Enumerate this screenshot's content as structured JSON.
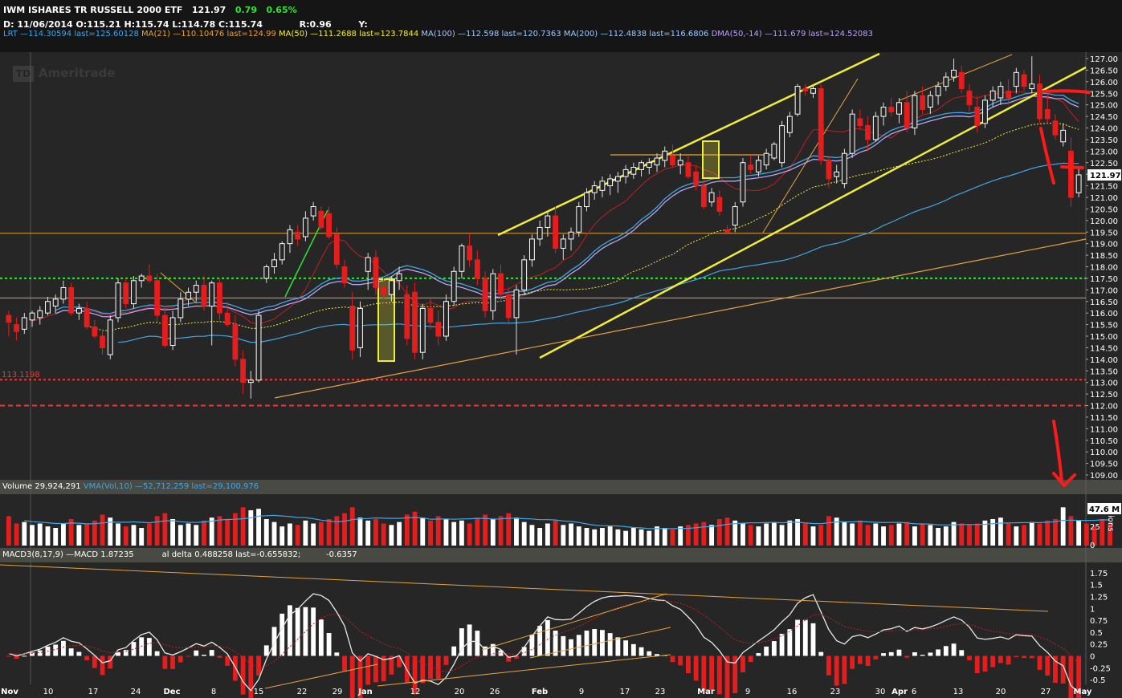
{
  "header": {
    "symbol_line": "IWM ISHARES TR RUSSELL 2000 ETF",
    "last": "121.97",
    "change": "0.79",
    "change_pct": "0.65%",
    "ohlc_line": "D: 11/06/2014 O:115.21 H:115.74 L:114.78 C:115.74",
    "r_label": "R:0.96",
    "y_label": "Y:",
    "studies": [
      {
        "text": "LRT —114.30594 last=125.60128",
        "color": "#3fa6e6"
      },
      {
        "text": "MA(21) —110.10476 last=124.99",
        "color": "#e6a23c"
      },
      {
        "text": "MA(50) —111.2688 last=123.7844",
        "color": "#f2ee35"
      },
      {
        "text": "MA(100) —112.598 last=120.7363",
        "color": "#9ec9ff"
      },
      {
        "text": "MA(200) —112.4838 last=116.6806",
        "color": "#9ec9ff"
      },
      {
        "text": "DMA(50,-14) —111.679 last=124.52083",
        "color": "#b9a3f0"
      }
    ]
  },
  "watermark": {
    "logo": "TD",
    "text": "Ameritrade"
  },
  "price_panel": {
    "last_badge": "121.97",
    "level_label": "113.1198",
    "y_ticks": [
      "127.00",
      "126.50",
      "126.00",
      "125.50",
      "125.00",
      "124.50",
      "124.00",
      "123.50",
      "123.00",
      "122.50",
      "122.00",
      "121.50",
      "121.00",
      "120.50",
      "120.00",
      "119.50",
      "119.00",
      "118.50",
      "118.00",
      "117.50",
      "117.00",
      "116.50",
      "116.00",
      "115.50",
      "115.00",
      "114.50",
      "114.00",
      "113.50",
      "113.00",
      "112.50",
      "112.00",
      "111.50",
      "111.00",
      "110.50",
      "110.00",
      "109.50",
      "109.00"
    ]
  },
  "volume_panel": {
    "label": "Volume 29,924,291",
    "vma_label": "VMA(Vol,10) —52,712,259 last=29,100,976",
    "badge": "47.6 M",
    "y_ticks": [
      "25",
      "0"
    ],
    "unit": "ions"
  },
  "macd_panel": {
    "label": "MACD3(8,17,9) —MACD 1.87235",
    "delta_label": "al delta 0.488258 last=-0.655832;",
    "last_label": "-0.6357",
    "y_ticks": [
      "1.75",
      "1.5",
      "1.25",
      "1",
      "0.75",
      "0.5",
      "0.25",
      "0",
      "-0.25",
      "-0.5"
    ]
  },
  "x_axis": {
    "labels": [
      "Nov",
      "10",
      "17",
      "24",
      "Dec",
      "8",
      "15",
      "22",
      "29",
      "Jan",
      "12",
      "20",
      "26",
      "Feb",
      "9",
      "17",
      "23",
      "Mar",
      "9",
      "16",
      "23",
      "30",
      "Apr",
      "6",
      "13",
      "20",
      "27",
      "May"
    ]
  },
  "chart_data": {
    "type": "candlestick",
    "ylim": [
      109.0,
      127.0
    ],
    "levels": [
      119.45,
      117.5,
      116.65,
      113.12,
      112.0
    ],
    "candles": [
      {
        "o": 115.9,
        "h": 116.1,
        "l": 115.0,
        "c": 115.6
      },
      {
        "o": 115.5,
        "h": 115.8,
        "l": 114.8,
        "c": 115.2
      },
      {
        "o": 115.3,
        "h": 116.0,
        "l": 115.1,
        "c": 115.8
      },
      {
        "o": 115.7,
        "h": 116.1,
        "l": 115.4,
        "c": 116.0
      },
      {
        "o": 115.8,
        "h": 116.3,
        "l": 115.5,
        "c": 116.1
      },
      {
        "o": 116.0,
        "h": 116.7,
        "l": 115.9,
        "c": 116.5
      },
      {
        "o": 116.3,
        "h": 116.8,
        "l": 116.0,
        "c": 116.6
      },
      {
        "o": 116.6,
        "h": 117.4,
        "l": 116.4,
        "c": 117.1
      },
      {
        "o": 117.1,
        "h": 117.3,
        "l": 115.9,
        "c": 116.0
      },
      {
        "o": 116.0,
        "h": 116.4,
        "l": 115.7,
        "c": 116.2
      },
      {
        "o": 116.2,
        "h": 116.5,
        "l": 115.3,
        "c": 115.4
      },
      {
        "o": 115.4,
        "h": 115.7,
        "l": 114.9,
        "c": 115.0
      },
      {
        "o": 115.0,
        "h": 115.3,
        "l": 114.2,
        "c": 114.5
      },
      {
        "o": 114.2,
        "h": 115.9,
        "l": 114.0,
        "c": 115.7
      },
      {
        "o": 115.8,
        "h": 117.5,
        "l": 115.6,
        "c": 117.3
      },
      {
        "o": 117.3,
        "h": 117.5,
        "l": 116.2,
        "c": 116.4
      },
      {
        "o": 116.4,
        "h": 117.6,
        "l": 116.2,
        "c": 117.4
      },
      {
        "o": 117.4,
        "h": 117.7,
        "l": 117.1,
        "c": 117.6
      },
      {
        "o": 117.6,
        "h": 118.1,
        "l": 117.3,
        "c": 117.4
      },
      {
        "o": 117.4,
        "h": 117.7,
        "l": 115.6,
        "c": 115.9
      },
      {
        "o": 115.9,
        "h": 116.3,
        "l": 114.5,
        "c": 114.6
      },
      {
        "o": 114.6,
        "h": 116.1,
        "l": 114.4,
        "c": 115.8
      },
      {
        "o": 115.8,
        "h": 116.9,
        "l": 115.6,
        "c": 116.6
      },
      {
        "o": 116.6,
        "h": 117.1,
        "l": 116.3,
        "c": 116.9
      },
      {
        "o": 116.9,
        "h": 117.4,
        "l": 116.5,
        "c": 117.2
      },
      {
        "o": 117.2,
        "h": 117.6,
        "l": 116.1,
        "c": 116.3
      },
      {
        "o": 116.3,
        "h": 117.4,
        "l": 114.6,
        "c": 117.3
      },
      {
        "o": 117.3,
        "h": 117.5,
        "l": 115.7,
        "c": 116.0
      },
      {
        "o": 116.0,
        "h": 116.5,
        "l": 115.4,
        "c": 115.5
      },
      {
        "o": 115.5,
        "h": 115.9,
        "l": 113.7,
        "c": 114.0
      },
      {
        "o": 114.0,
        "h": 114.4,
        "l": 112.5,
        "c": 113.0
      },
      {
        "o": 113.0,
        "h": 113.5,
        "l": 112.3,
        "c": 113.1
      },
      {
        "o": 113.1,
        "h": 116.1,
        "l": 113.0,
        "c": 115.9
      },
      {
        "o": 117.5,
        "h": 118.1,
        "l": 117.3,
        "c": 118.0
      },
      {
        "o": 118.0,
        "h": 118.6,
        "l": 117.7,
        "c": 118.3
      },
      {
        "o": 118.3,
        "h": 119.1,
        "l": 118.1,
        "c": 119.0
      },
      {
        "o": 119.0,
        "h": 119.8,
        "l": 118.6,
        "c": 119.6
      },
      {
        "o": 119.5,
        "h": 119.8,
        "l": 118.9,
        "c": 119.2
      },
      {
        "o": 119.3,
        "h": 120.4,
        "l": 119.1,
        "c": 120.1
      },
      {
        "o": 120.2,
        "h": 120.8,
        "l": 120.0,
        "c": 120.6
      },
      {
        "o": 120.4,
        "h": 120.6,
        "l": 119.6,
        "c": 119.7
      },
      {
        "o": 120.3,
        "h": 120.6,
        "l": 119.2,
        "c": 119.3
      },
      {
        "o": 119.4,
        "h": 119.7,
        "l": 117.9,
        "c": 118.1
      },
      {
        "o": 118.0,
        "h": 118.3,
        "l": 117.1,
        "c": 117.3
      },
      {
        "o": 116.3,
        "h": 116.9,
        "l": 114.0,
        "c": 114.4
      },
      {
        "o": 114.5,
        "h": 116.5,
        "l": 114.1,
        "c": 116.2
      },
      {
        "o": 117.8,
        "h": 118.6,
        "l": 117.0,
        "c": 118.4
      },
      {
        "o": 118.4,
        "h": 118.7,
        "l": 116.8,
        "c": 117.1
      },
      {
        "o": 117.1,
        "h": 117.5,
        "l": 116.3,
        "c": 116.8
      },
      {
        "o": 116.8,
        "h": 117.6,
        "l": 116.5,
        "c": 117.4
      },
      {
        "o": 117.4,
        "h": 118.0,
        "l": 117.0,
        "c": 117.7
      },
      {
        "o": 116.8,
        "h": 117.2,
        "l": 114.6,
        "c": 114.9
      },
      {
        "o": 116.9,
        "h": 117.3,
        "l": 114.0,
        "c": 114.3
      },
      {
        "o": 114.3,
        "h": 116.4,
        "l": 114.0,
        "c": 116.2
      },
      {
        "o": 116.2,
        "h": 116.6,
        "l": 115.3,
        "c": 115.6
      },
      {
        "o": 115.6,
        "h": 116.1,
        "l": 114.6,
        "c": 115.0
      },
      {
        "o": 115.0,
        "h": 116.8,
        "l": 114.8,
        "c": 116.5
      },
      {
        "o": 116.5,
        "h": 118.0,
        "l": 116.3,
        "c": 117.8
      },
      {
        "o": 117.8,
        "h": 119.0,
        "l": 117.5,
        "c": 118.9
      },
      {
        "o": 118.9,
        "h": 119.5,
        "l": 118.0,
        "c": 118.3
      },
      {
        "o": 118.3,
        "h": 118.7,
        "l": 117.2,
        "c": 117.5
      },
      {
        "o": 117.5,
        "h": 117.8,
        "l": 115.8,
        "c": 116.1
      },
      {
        "o": 116.1,
        "h": 117.9,
        "l": 115.7,
        "c": 117.7
      },
      {
        "o": 117.7,
        "h": 118.1,
        "l": 116.5,
        "c": 116.8
      },
      {
        "o": 116.8,
        "h": 117.1,
        "l": 115.5,
        "c": 115.8
      },
      {
        "o": 115.8,
        "h": 117.2,
        "l": 114.2,
        "c": 117.0
      },
      {
        "o": 117.0,
        "h": 118.5,
        "l": 116.8,
        "c": 118.3
      },
      {
        "o": 118.3,
        "h": 119.4,
        "l": 118.0,
        "c": 119.2
      },
      {
        "o": 119.2,
        "h": 120.0,
        "l": 118.9,
        "c": 119.7
      },
      {
        "o": 119.7,
        "h": 120.4,
        "l": 119.3,
        "c": 120.2
      },
      {
        "o": 120.2,
        "h": 120.6,
        "l": 118.6,
        "c": 118.8
      },
      {
        "o": 118.8,
        "h": 119.4,
        "l": 118.3,
        "c": 119.2
      },
      {
        "o": 119.2,
        "h": 119.7,
        "l": 118.7,
        "c": 119.5
      },
      {
        "o": 119.5,
        "h": 120.8,
        "l": 119.3,
        "c": 120.6
      },
      {
        "o": 120.6,
        "h": 121.4,
        "l": 120.4,
        "c": 121.2
      },
      {
        "o": 121.2,
        "h": 121.7,
        "l": 120.9,
        "c": 121.5
      },
      {
        "o": 121.3,
        "h": 121.9,
        "l": 121.0,
        "c": 121.7
      },
      {
        "o": 121.5,
        "h": 122.0,
        "l": 121.1,
        "c": 121.8
      },
      {
        "o": 121.7,
        "h": 122.1,
        "l": 121.2,
        "c": 121.9
      },
      {
        "o": 121.9,
        "h": 122.4,
        "l": 121.6,
        "c": 122.2
      },
      {
        "o": 122.0,
        "h": 122.5,
        "l": 121.8,
        "c": 122.3
      },
      {
        "o": 122.2,
        "h": 122.6,
        "l": 121.9,
        "c": 122.5
      },
      {
        "o": 122.3,
        "h": 122.7,
        "l": 122.0,
        "c": 122.5
      },
      {
        "o": 122.4,
        "h": 122.9,
        "l": 122.1,
        "c": 122.7
      },
      {
        "o": 122.6,
        "h": 123.2,
        "l": 122.3,
        "c": 123.0
      },
      {
        "o": 122.8,
        "h": 123.3,
        "l": 122.3,
        "c": 122.4
      },
      {
        "o": 122.4,
        "h": 122.9,
        "l": 122.0,
        "c": 122.6
      },
      {
        "o": 122.5,
        "h": 122.8,
        "l": 121.8,
        "c": 121.9
      },
      {
        "o": 122.1,
        "h": 122.4,
        "l": 121.3,
        "c": 121.5
      },
      {
        "o": 121.5,
        "h": 121.8,
        "l": 120.5,
        "c": 120.6
      },
      {
        "o": 120.8,
        "h": 121.4,
        "l": 120.6,
        "c": 121.2
      },
      {
        "o": 121.0,
        "h": 121.3,
        "l": 120.2,
        "c": 120.4
      },
      {
        "o": 119.6,
        "h": 119.8,
        "l": 119.4,
        "c": 119.5
      },
      {
        "o": 119.8,
        "h": 120.8,
        "l": 119.5,
        "c": 120.6
      },
      {
        "o": 120.8,
        "h": 122.7,
        "l": 120.6,
        "c": 122.5
      },
      {
        "o": 122.4,
        "h": 122.8,
        "l": 122.0,
        "c": 122.2
      },
      {
        "o": 122.1,
        "h": 122.8,
        "l": 121.9,
        "c": 122.6
      },
      {
        "o": 122.4,
        "h": 123.1,
        "l": 122.2,
        "c": 122.9
      },
      {
        "o": 122.7,
        "h": 123.4,
        "l": 122.6,
        "c": 123.3
      },
      {
        "o": 122.5,
        "h": 124.3,
        "l": 122.3,
        "c": 124.1
      },
      {
        "o": 123.8,
        "h": 124.7,
        "l": 123.6,
        "c": 124.5
      },
      {
        "o": 124.6,
        "h": 125.9,
        "l": 124.5,
        "c": 125.8
      },
      {
        "o": 125.7,
        "h": 125.9,
        "l": 125.4,
        "c": 125.6
      },
      {
        "o": 125.5,
        "h": 125.8,
        "l": 125.3,
        "c": 125.7
      },
      {
        "o": 125.7,
        "h": 125.9,
        "l": 122.4,
        "c": 122.6
      },
      {
        "o": 122.6,
        "h": 122.8,
        "l": 121.4,
        "c": 121.8
      },
      {
        "o": 121.9,
        "h": 122.4,
        "l": 121.6,
        "c": 122.1
      },
      {
        "o": 121.6,
        "h": 123.1,
        "l": 121.4,
        "c": 122.9
      },
      {
        "o": 122.9,
        "h": 124.8,
        "l": 122.7,
        "c": 124.6
      },
      {
        "o": 124.4,
        "h": 124.8,
        "l": 123.9,
        "c": 124.1
      },
      {
        "o": 124.1,
        "h": 124.5,
        "l": 123.0,
        "c": 123.5
      },
      {
        "o": 123.5,
        "h": 124.7,
        "l": 123.4,
        "c": 124.5
      },
      {
        "o": 124.5,
        "h": 125.1,
        "l": 124.1,
        "c": 124.9
      },
      {
        "o": 124.9,
        "h": 125.3,
        "l": 124.5,
        "c": 124.7
      },
      {
        "o": 124.6,
        "h": 125.3,
        "l": 124.2,
        "c": 125.1
      },
      {
        "o": 125.1,
        "h": 125.6,
        "l": 123.8,
        "c": 124.0
      },
      {
        "o": 124.0,
        "h": 125.6,
        "l": 123.7,
        "c": 125.4
      },
      {
        "o": 125.4,
        "h": 125.8,
        "l": 124.6,
        "c": 124.8
      },
      {
        "o": 124.9,
        "h": 125.6,
        "l": 124.6,
        "c": 125.4
      },
      {
        "o": 125.4,
        "h": 126.0,
        "l": 125.0,
        "c": 125.8
      },
      {
        "o": 125.8,
        "h": 126.4,
        "l": 125.6,
        "c": 126.2
      },
      {
        "o": 126.2,
        "h": 127.0,
        "l": 126.0,
        "c": 126.5
      },
      {
        "o": 126.4,
        "h": 126.7,
        "l": 125.5,
        "c": 125.7
      },
      {
        "o": 125.6,
        "h": 125.9,
        "l": 124.7,
        "c": 125.0
      },
      {
        "o": 124.9,
        "h": 125.4,
        "l": 123.8,
        "c": 124.1
      },
      {
        "o": 124.2,
        "h": 125.4,
        "l": 124.0,
        "c": 125.2
      },
      {
        "o": 125.2,
        "h": 125.8,
        "l": 124.9,
        "c": 125.6
      },
      {
        "o": 125.3,
        "h": 126.0,
        "l": 125.0,
        "c": 125.8
      },
      {
        "o": 125.6,
        "h": 126.1,
        "l": 125.0,
        "c": 125.3
      },
      {
        "o": 125.8,
        "h": 126.6,
        "l": 125.5,
        "c": 126.4
      },
      {
        "o": 126.3,
        "h": 126.5,
        "l": 125.6,
        "c": 125.8
      },
      {
        "o": 125.7,
        "h": 127.1,
        "l": 125.5,
        "c": 125.9
      },
      {
        "o": 125.9,
        "h": 126.3,
        "l": 124.2,
        "c": 124.4
      },
      {
        "o": 124.8,
        "h": 125.5,
        "l": 124.2,
        "c": 124.4
      },
      {
        "o": 124.3,
        "h": 124.6,
        "l": 123.5,
        "c": 123.7
      },
      {
        "o": 123.4,
        "h": 124.2,
        "l": 123.2,
        "c": 123.9
      },
      {
        "o": 123.0,
        "h": 123.6,
        "l": 120.6,
        "c": 121.0
      },
      {
        "o": 121.2,
        "h": 122.3,
        "l": 121.0,
        "c": 121.97
      }
    ],
    "volume": [
      40,
      30,
      32,
      28,
      30,
      26,
      24,
      30,
      36,
      28,
      30,
      34,
      42,
      38,
      30,
      26,
      28,
      24,
      30,
      40,
      44,
      36,
      28,
      30,
      28,
      34,
      38,
      40,
      36,
      44,
      52,
      48,
      50,
      36,
      32,
      26,
      30,
      28,
      34,
      30,
      32,
      36,
      40,
      44,
      52,
      38,
      34,
      36,
      30,
      28,
      32,
      42,
      46,
      38,
      34,
      40,
      36,
      32,
      34,
      30,
      38,
      42,
      36,
      40,
      44,
      38,
      32,
      28,
      24,
      30,
      34,
      28,
      30,
      26,
      24,
      22,
      24,
      26,
      22,
      20,
      24,
      22,
      20,
      26,
      24,
      22,
      26,
      28,
      30,
      32,
      28,
      36,
      38,
      34,
      30,
      28,
      26,
      30,
      32,
      28,
      34,
      36,
      30,
      26,
      28,
      40,
      38,
      32,
      30,
      34,
      28,
      30,
      26,
      28,
      30,
      32,
      26,
      30,
      28,
      24,
      26,
      32,
      30,
      28,
      30,
      34,
      36,
      38,
      30,
      26,
      28,
      32,
      30,
      34,
      36,
      52,
      40,
      34,
      30,
      26,
      36,
      30
    ],
    "volume_ylim": [
      0,
      60
    ],
    "macd": {
      "ylim": [
        -0.6,
        1.85
      ],
      "zero_line": 0
    }
  }
}
